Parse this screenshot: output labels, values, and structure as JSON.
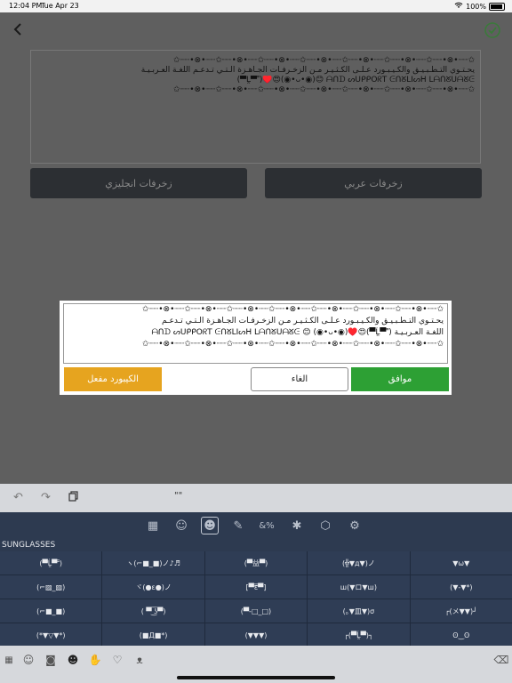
{
  "status": {
    "time": "12:04 PM",
    "date": "Tue Apr 23",
    "battery": "100%"
  },
  "background": {
    "text_lines": [
      "✩┈┈•⊗•┈┈✩┈┈•⊗•┈┈✩┈┈•⊗•┈┈✩┈┈•⊗•┈┈✩┈┈•⊗•┈┈✩┈┈•⊗•┈┈✩┈┈•⊗•┈┈✩",
      "يحـتـوي التـطـبـيـق والكـيـبـورد عـلـى الكـثـيـر مـن الزخـرفـات الجـاهـزة الـتـي تـدعـم اللغـة العـربـيـة",
      "(▀̿Ĺ̯▀̿ ̿)♥️😍(◉•ᴗ•◉)😊 ᗩᑎᗪ ᔕᑌᑭᑭOᖇT ᕮᑎᘜᒪIᔕᕼ ᒪᗩᑎᘜᑌᗩᘜᕮ",
      "✩┈┈•⊗•┈┈✩┈┈•⊗•┈┈✩┈┈•⊗•┈┈✩┈┈•⊗•┈┈✩┈┈•⊗•┈┈✩┈┈•⊗•┈┈✩┈┈•⊗•┈┈✩"
    ],
    "english_button": "زخرفات انجليزي",
    "arabic_button": "زخرفات عربي"
  },
  "dialog": {
    "text_lines": [
      "✩┈┈•⊗•┈┈✩┈┈•⊗•┈┈✩┈┈•⊗•┈┈✩┈┈•⊗•┈┈✩┈┈•⊗•┈┈✩┈┈•⊗•┈┈✩┈┈•⊗•┈┈✩",
      "يحـتـوي التـطـبـيـق والكـيـبـورد عـلـى الكـثـيـر مـن الزخـرفـات الجـاهـزة الـتـي تـدعـم",
      "ᗩᑎᗪ ᔕᑌᑭᑭOᖇT ᕮᑎᘜᒪIᔕᕼ ᒪᗩᑎᘜᑌᗩᘜᕮ 😊 (◉•ᴗ•◉)♥️😍(▀̿Ĺ̯▀̿ ̿) اللغـة العـربـيـة",
      "✩┈┈•⊗•┈┈✩┈┈•⊗•┈┈✩┈┈•⊗•┈┈✩┈┈•⊗•┈┈✩┈┈•⊗•┈┈✩┈┈•⊗•┈┈✩┈┈•⊗•┈┈✩"
    ],
    "ok": "موافق",
    "cancel": "الغاء",
    "keyboard_enabled": "الكيبورد مفعل"
  },
  "keyboard": {
    "quote_key": "\"\"",
    "category": "SUNGLASSES",
    "kaomoji": [
      "(▀̿Ĺ̯▀̿ ̿)",
      "ヽ(⌐■_■)ノ♪♬",
      "(▀益▀)",
      "(╬▼д▼)ノ",
      "▼ω▼",
      "(⌐▨_▨)",
      "ヾ(●ε●)ノ",
      "[▀ɛ̿▀]",
      "ш(▼ロ▼ш)",
      "(▼-▼*)",
      "(⌐■_■)",
      "( ▀ ͜͞ʖ▀)",
      "(▀̿-□_□)",
      "(｡▼皿▼)σ",
      "┌(メ▼▼)┘",
      "(*▼▽▼*)",
      "(■Д■*)",
      "(▼▼▼)",
      "┌(▀Ĺ̯▀)┐",
      "ʘ‿ʘ"
    ],
    "colors": {
      "tab_bg": "#2d3a50",
      "cell_bg": "#2f3d55",
      "toolbar_bg": "#d6d8dc"
    }
  },
  "colors": {
    "ok_green": "#2da034",
    "keyboard_orange": "#e6a41f",
    "check_green": "#3a9a3a"
  }
}
